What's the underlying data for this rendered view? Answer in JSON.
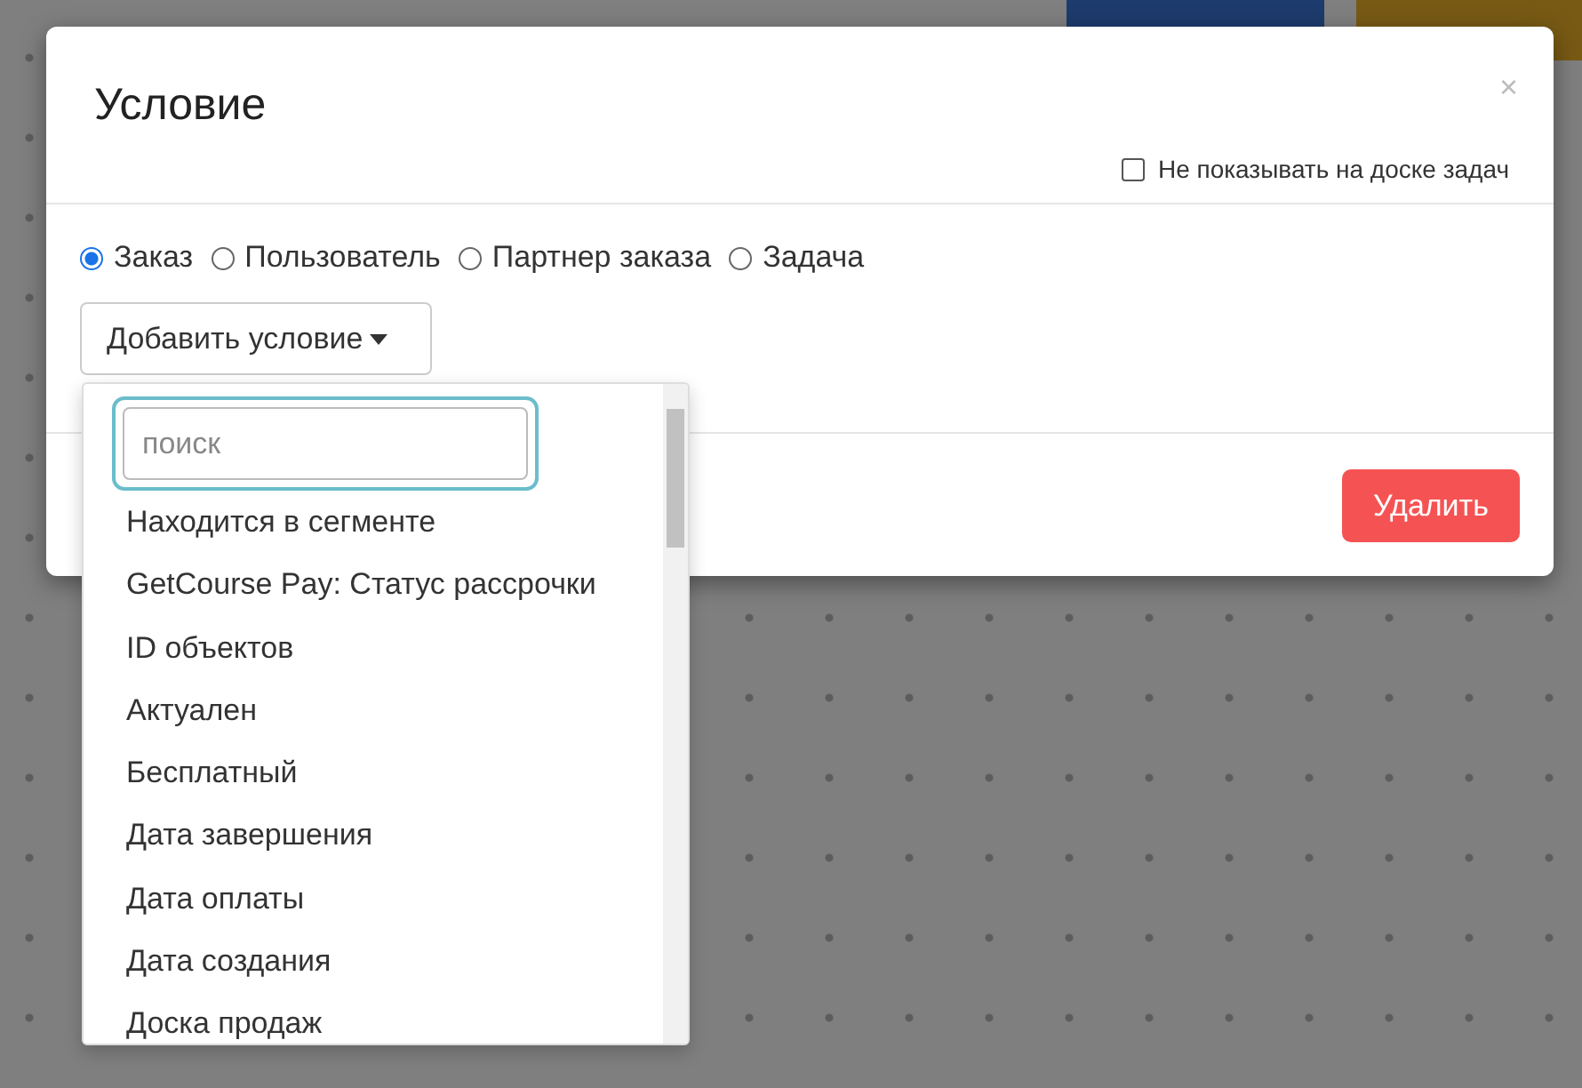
{
  "dialog": {
    "title": "Условие",
    "close": "×",
    "hide_checkbox": {
      "label": "Не показывать на доске задач",
      "checked": false
    },
    "scopes": [
      {
        "label": "Заказ",
        "selected": true
      },
      {
        "label": "Пользователь",
        "selected": false
      },
      {
        "label": "Партнер заказа",
        "selected": false
      },
      {
        "label": "Задача",
        "selected": false
      }
    ],
    "add_button": "Добавить условие",
    "delete_button": "Удалить"
  },
  "dropdown": {
    "search": {
      "placeholder": "поиск"
    },
    "items": [
      "Находится в сегменте",
      "GetCourse Pay: Статус рассрочки",
      "ID объектов",
      "Актуален",
      "Бесплатный",
      "Дата завершения",
      "Дата оплаты",
      "Дата создания",
      "Доска продаж"
    ]
  }
}
